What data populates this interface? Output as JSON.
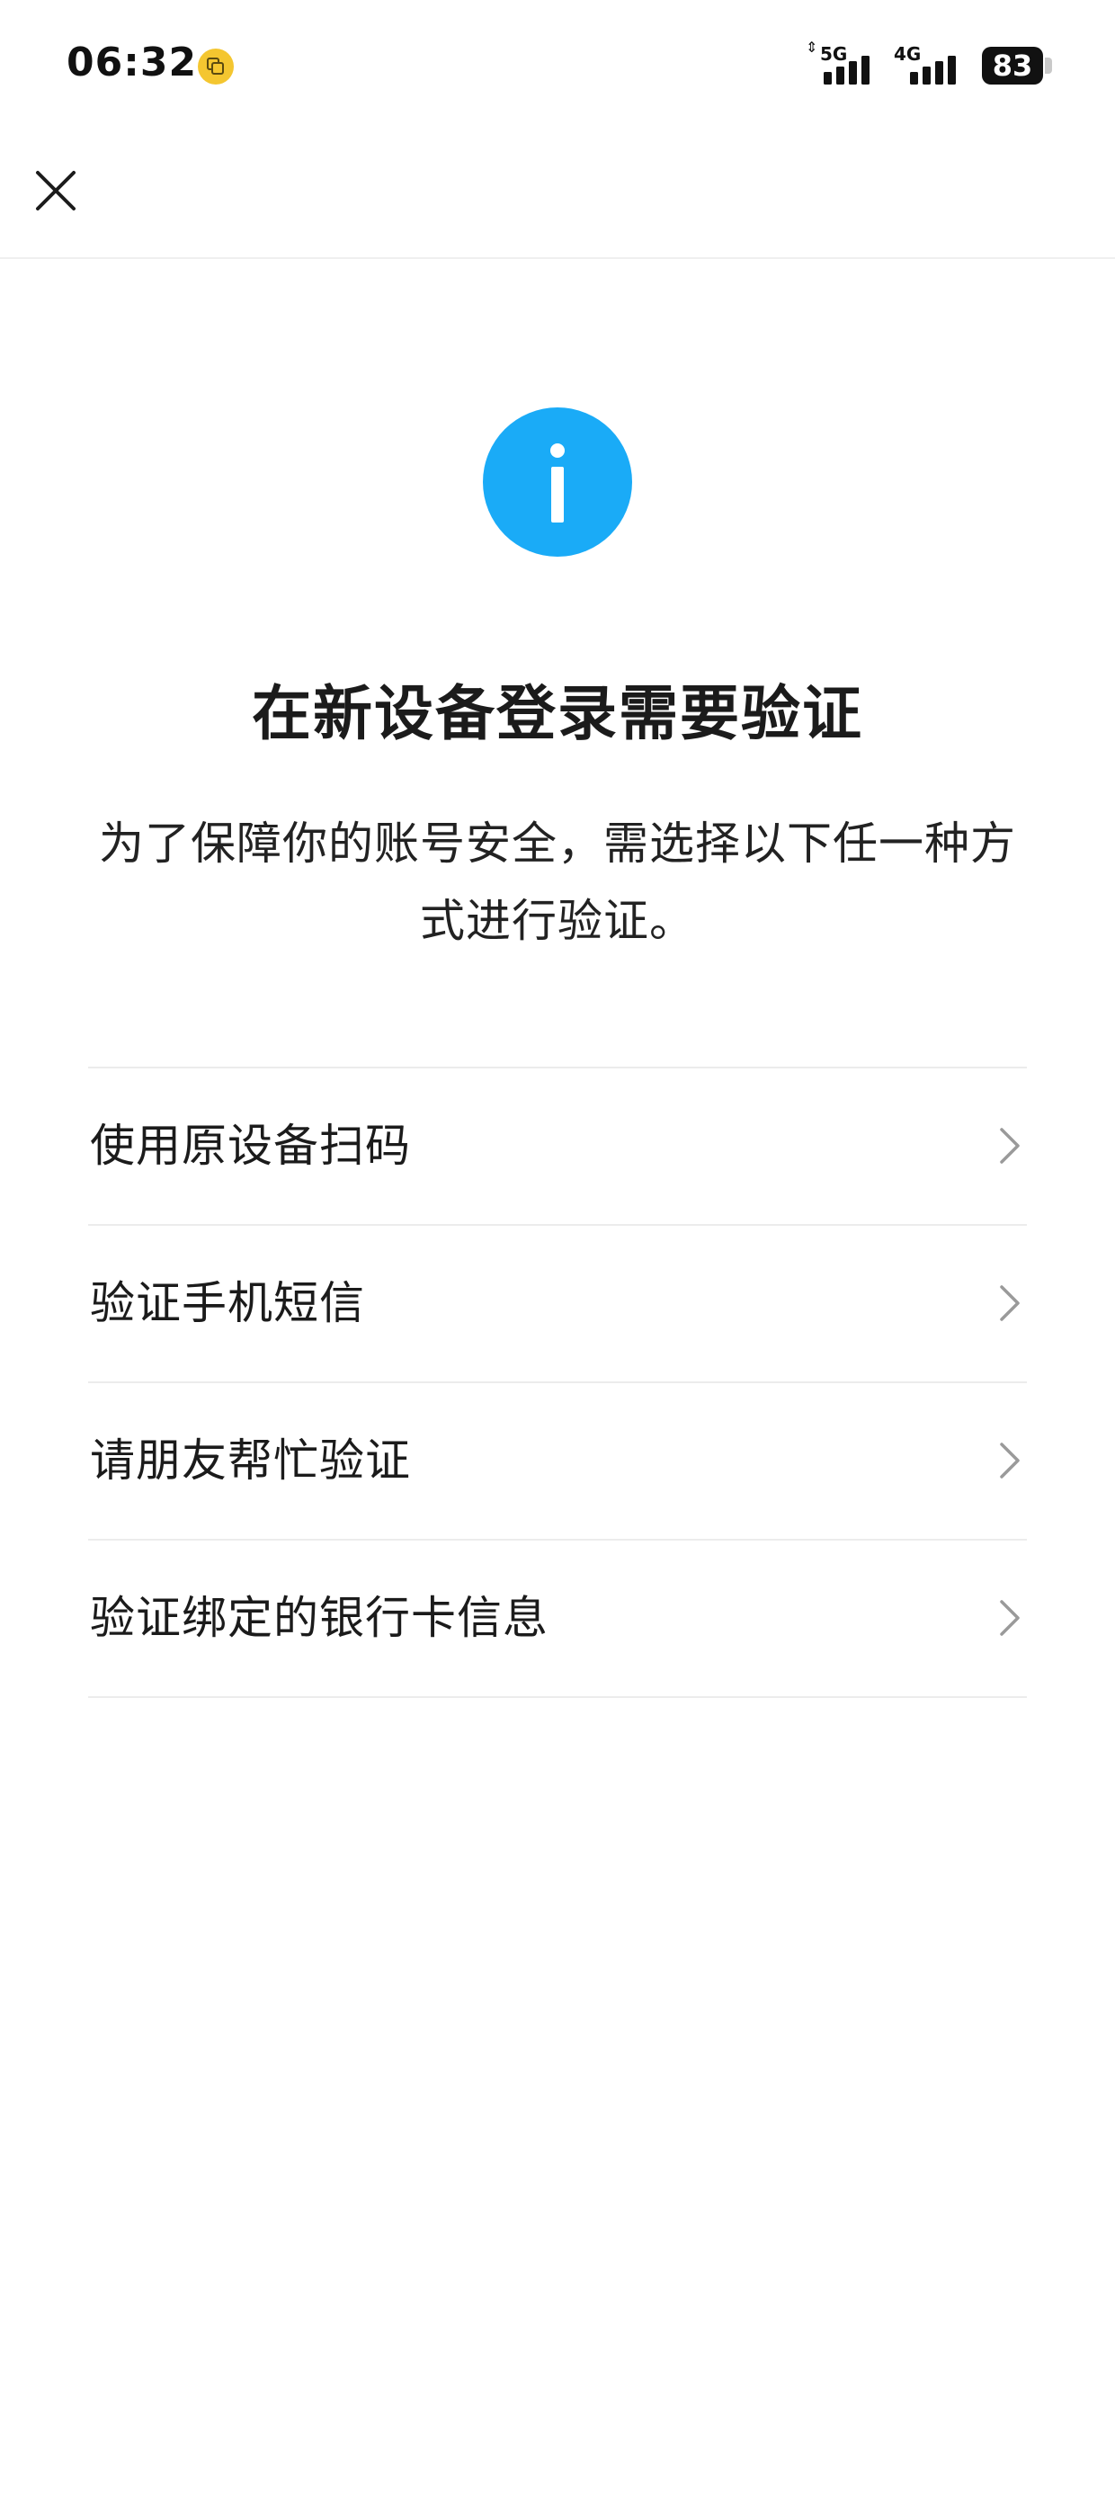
{
  "status_bar": {
    "time": "06:32",
    "network_1": "5G",
    "network_2": "4G",
    "battery": "83"
  },
  "icons": {
    "close": "close-icon",
    "info": "info-icon",
    "chevron": "chevron-right-icon",
    "status_app": "copy-icon"
  },
  "colors": {
    "accent": "#1aabf7",
    "status_app_icon": "#f4c630",
    "divider": "#ececec"
  },
  "main": {
    "title": "在新设备登录需要验证",
    "description": "为了保障你的账号安全，需选择以下任一种方式进行验证。",
    "options": [
      {
        "label": "使用原设备扫码"
      },
      {
        "label": "验证手机短信"
      },
      {
        "label": "请朋友帮忙验证"
      },
      {
        "label": "验证绑定的银行卡信息"
      }
    ]
  }
}
